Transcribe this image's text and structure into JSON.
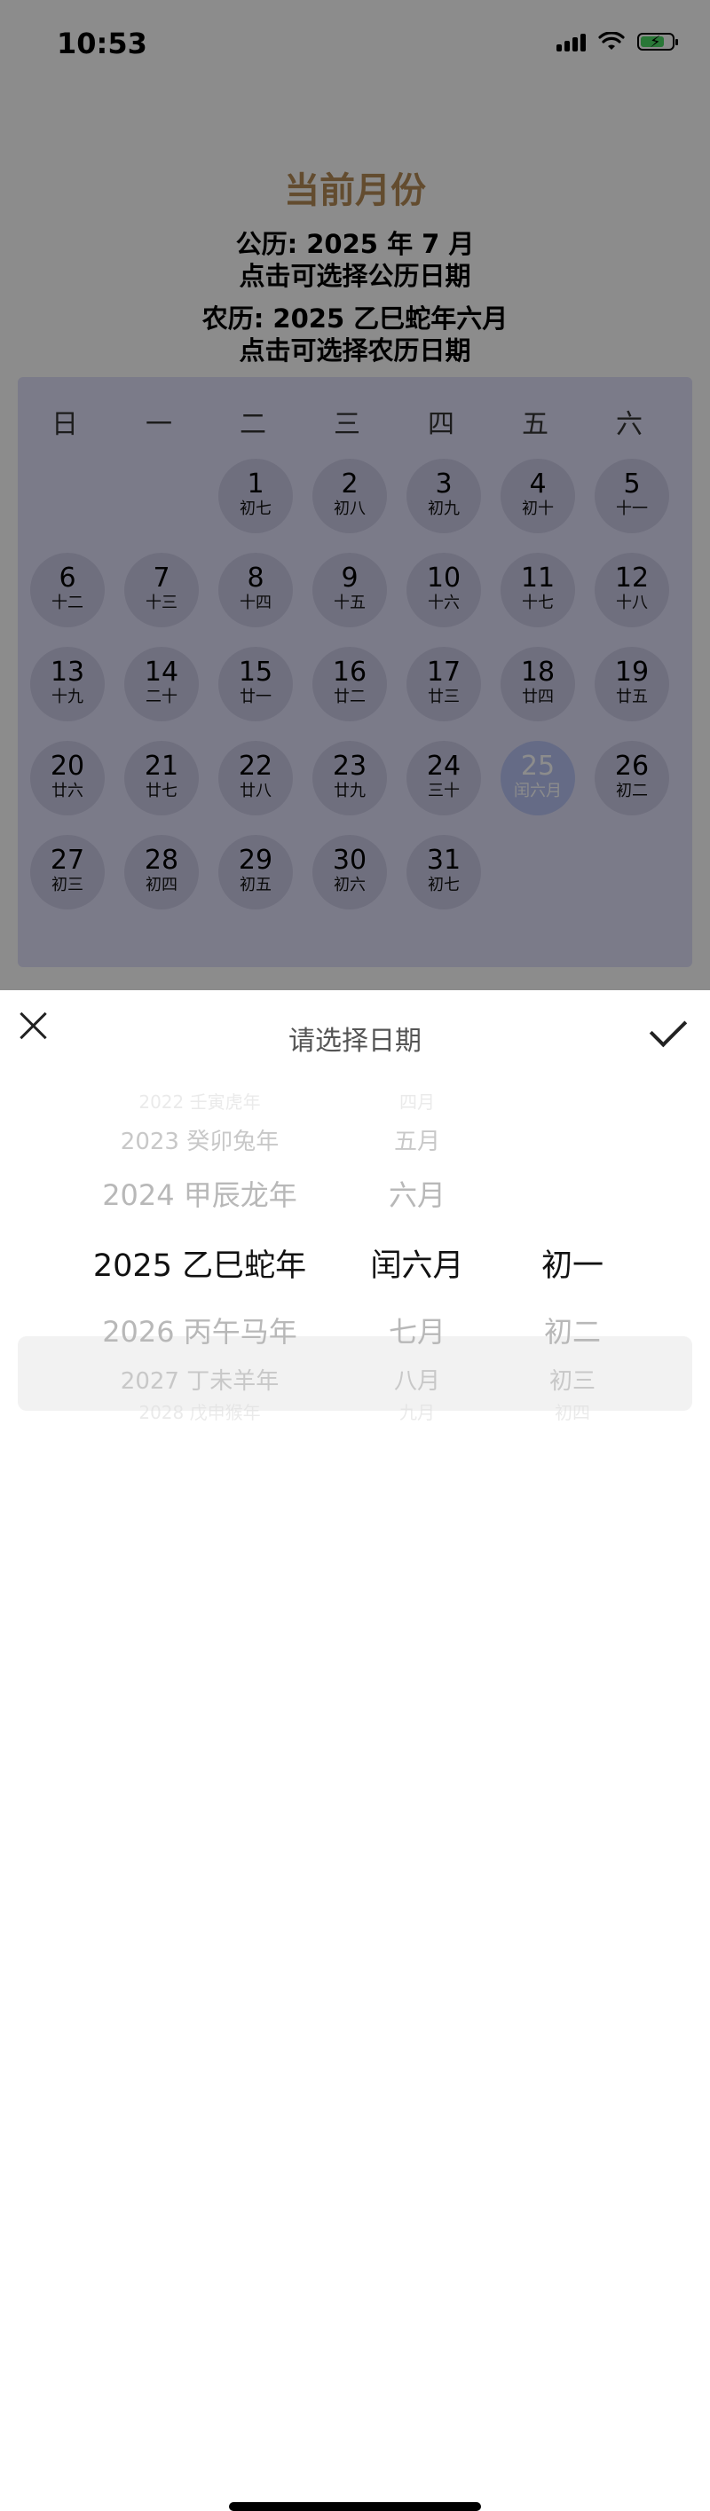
{
  "status_bar": {
    "time": "10:53"
  },
  "page": {
    "title": "当前月份",
    "solar_line": "公历: 2025 年 7 月",
    "solar_hint": "点击可选择公历日期",
    "lunar_line": "农历: 2025 乙巳蛇年六月",
    "lunar_hint": "点击可选择农历日期"
  },
  "calendar": {
    "weekdays": [
      "日",
      "一",
      "二",
      "三",
      "四",
      "五",
      "六"
    ],
    "days": [
      {
        "d": "1",
        "l": "初七"
      },
      {
        "d": "2",
        "l": "初八"
      },
      {
        "d": "3",
        "l": "初九"
      },
      {
        "d": "4",
        "l": "初十"
      },
      {
        "d": "5",
        "l": "十一"
      },
      {
        "d": "6",
        "l": "十二"
      },
      {
        "d": "7",
        "l": "十三"
      },
      {
        "d": "8",
        "l": "十四"
      },
      {
        "d": "9",
        "l": "十五"
      },
      {
        "d": "10",
        "l": "十六"
      },
      {
        "d": "11",
        "l": "十七"
      },
      {
        "d": "12",
        "l": "十八"
      },
      {
        "d": "13",
        "l": "十九"
      },
      {
        "d": "14",
        "l": "二十"
      },
      {
        "d": "15",
        "l": "廿一"
      },
      {
        "d": "16",
        "l": "廿二"
      },
      {
        "d": "17",
        "l": "廿三"
      },
      {
        "d": "18",
        "l": "廿四"
      },
      {
        "d": "19",
        "l": "廿五"
      },
      {
        "d": "20",
        "l": "廿六"
      },
      {
        "d": "21",
        "l": "廿七"
      },
      {
        "d": "22",
        "l": "廿八"
      },
      {
        "d": "23",
        "l": "廿九"
      },
      {
        "d": "24",
        "l": "三十"
      },
      {
        "d": "25",
        "l": "闰六月"
      },
      {
        "d": "26",
        "l": "初二"
      },
      {
        "d": "27",
        "l": "初三"
      },
      {
        "d": "28",
        "l": "初四"
      },
      {
        "d": "29",
        "l": "初五"
      },
      {
        "d": "30",
        "l": "初六"
      },
      {
        "d": "31",
        "l": "初七"
      }
    ],
    "first_weekday_index": 2,
    "highlighted_day": "25"
  },
  "picker": {
    "title": "请选择日期",
    "year": {
      "faded_top": "2022 壬寅虎年",
      "above2": "2023 癸卯兔年",
      "above1": "2024 甲辰龙年",
      "selected": "2025 乙巳蛇年",
      "below1": "2026 丙午马年",
      "below2": "2027 丁未羊年",
      "faded_bottom": "2028 戊申猴年"
    },
    "month": {
      "faded_top": "四月",
      "above2": "五月",
      "above1": "六月",
      "selected": "闰六月",
      "below1": "七月",
      "below2": "八月",
      "faded_bottom": "九月"
    },
    "day": {
      "selected": "初一",
      "below1": "初二",
      "below2": "初三",
      "faded_bottom": "初四"
    }
  }
}
